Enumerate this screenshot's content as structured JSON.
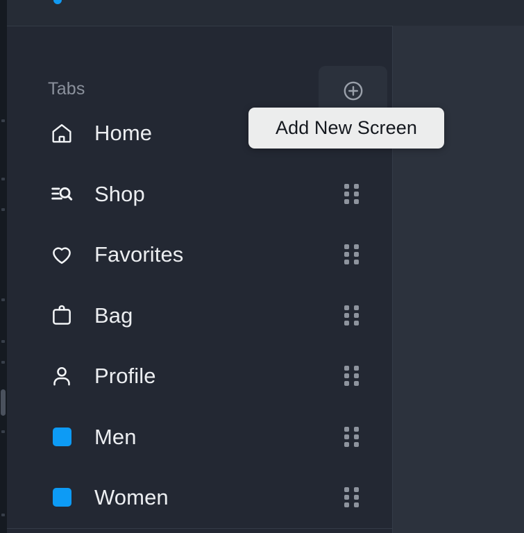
{
  "colors": {
    "panel_bg": "#232833",
    "top_strip_bg": "#262c36",
    "right_area_bg": "#2c323d",
    "divider": "#343b47",
    "accent_blue": "#119af2",
    "label_text": "#eceef1",
    "muted_text": "#8b919c",
    "tooltip_bg": "#eceded",
    "tooltip_text": "#14181e",
    "drag_dot": "#8e949e"
  },
  "top_strip": {
    "indicator_name": "blue-pill-indicator",
    "indicator_color": "#119af2"
  },
  "section": {
    "title": "Tabs",
    "add_button": {
      "icon": "plus-circle-icon",
      "label": "Add New Screen"
    }
  },
  "tooltip": {
    "text": "Add New Screen",
    "visible": true
  },
  "tabs": [
    {
      "label": "Home",
      "icon": "home-icon",
      "icon_type": "outline",
      "has_drag_handle": false
    },
    {
      "label": "Shop",
      "icon": "shop-search-icon",
      "icon_type": "outline",
      "has_drag_handle": true
    },
    {
      "label": "Favorites",
      "icon": "heart-icon",
      "icon_type": "outline",
      "has_drag_handle": true
    },
    {
      "label": "Bag",
      "icon": "bag-icon",
      "icon_type": "outline",
      "has_drag_handle": true
    },
    {
      "label": "Profile",
      "icon": "person-icon",
      "icon_type": "outline",
      "has_drag_handle": true
    },
    {
      "label": "Men",
      "icon": "blue-square-icon",
      "icon_type": "swatch",
      "swatch_color": "#0d9bf5",
      "has_drag_handle": true
    },
    {
      "label": "Women",
      "icon": "blue-square-icon",
      "icon_type": "swatch",
      "swatch_color": "#0d9bf5",
      "has_drag_handle": true
    }
  ],
  "scrollbar": {
    "name": "vertical-scrollbar",
    "thumb_top_pct": 73,
    "thumb_height_pct": 5
  }
}
